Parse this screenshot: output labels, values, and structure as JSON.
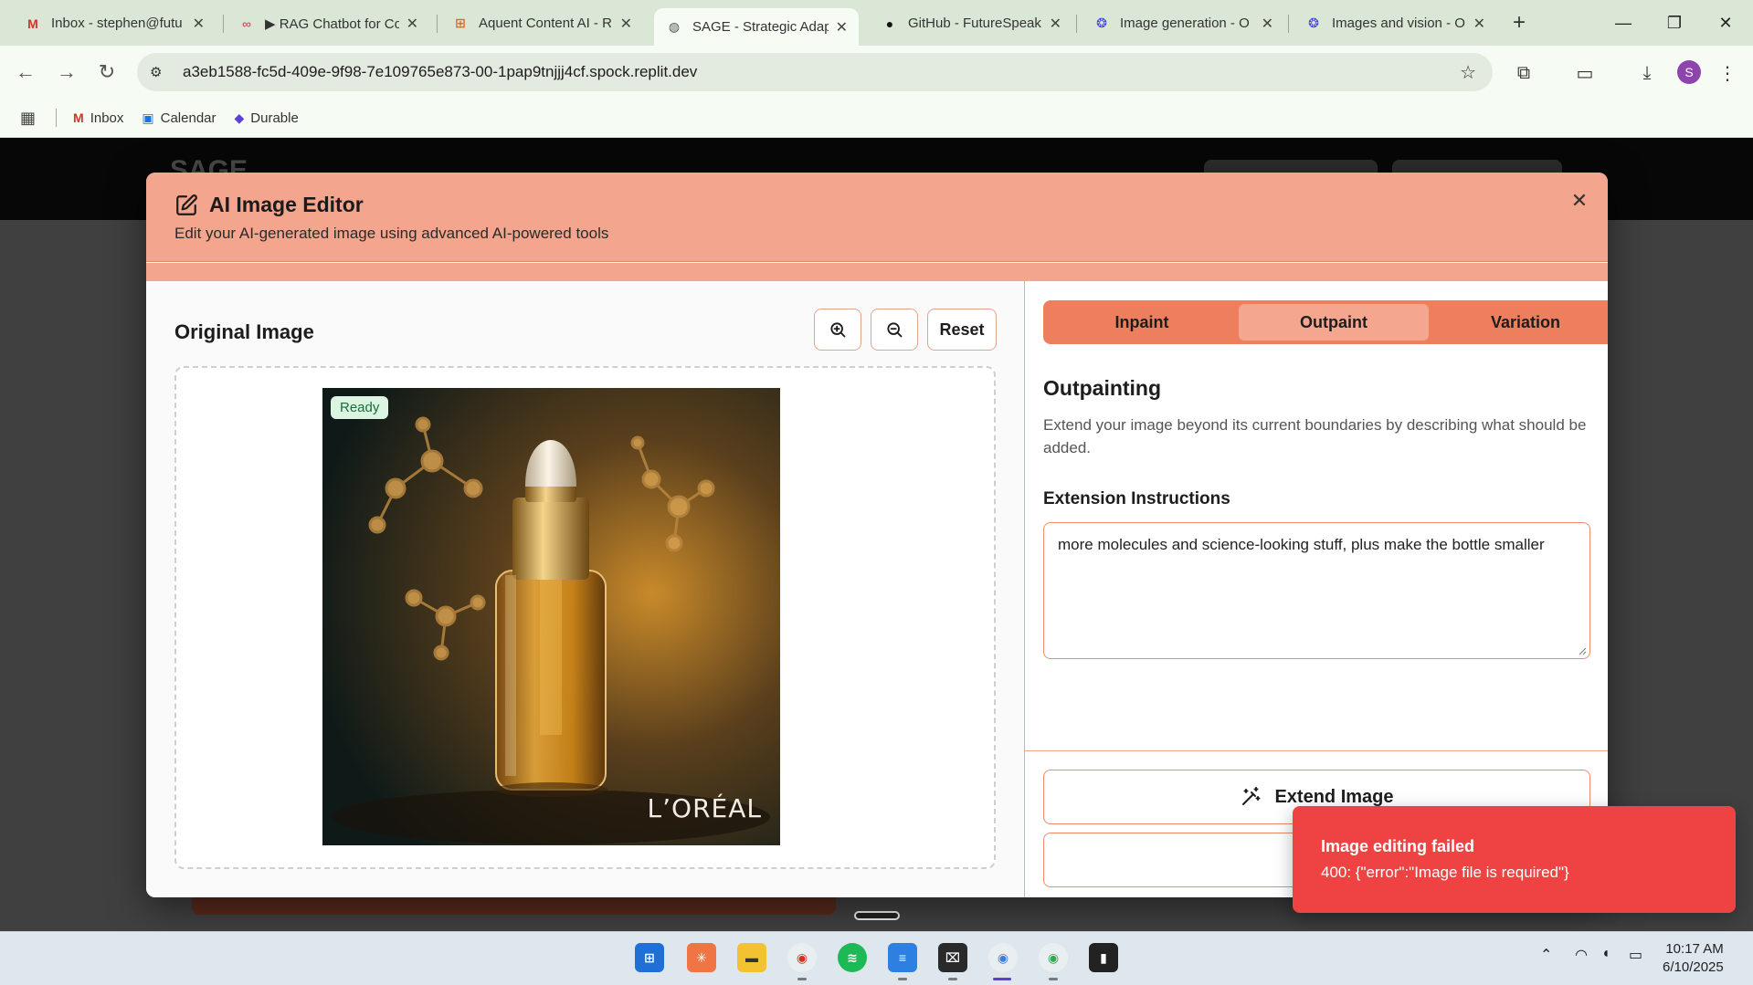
{
  "browser": {
    "tabs": [
      {
        "title": "Inbox - stephen@futu",
        "icon": "gmail-icon",
        "active": false
      },
      {
        "title": "▶ RAG Chatbot for Co",
        "icon": "workflow-icon",
        "active": false
      },
      {
        "title": "Aquent Content AI - R",
        "icon": "replit-icon",
        "active": false
      },
      {
        "title": "SAGE - Strategic Adap",
        "icon": "globe-icon",
        "active": true
      },
      {
        "title": "GitHub - FutureSpeak",
        "icon": "github-icon",
        "active": false
      },
      {
        "title": "Image generation - O",
        "icon": "openai-icon",
        "active": false
      },
      {
        "title": "Images and vision - O",
        "icon": "openai-icon",
        "active": false
      }
    ],
    "url": "a3eb1588-fc5d-409e-9f98-7e109765e873-00-1pap9tnjjj4cf.spock.replit.dev",
    "profile_initial": "S",
    "bookmarks": [
      {
        "label": "Inbox",
        "icon": "gmail-icon"
      },
      {
        "label": "Calendar",
        "icon": "calendar-icon"
      },
      {
        "label": "Durable",
        "icon": "durable-icon"
      }
    ]
  },
  "page": {
    "logo_text": "SAGE"
  },
  "modal": {
    "title": "AI Image Editor",
    "description": "Edit your AI-generated image using advanced AI-powered tools",
    "left": {
      "title": "Original Image",
      "reset_label": "Reset",
      "status_badge": "Ready",
      "brand_text": "L’ORÉAL"
    },
    "right": {
      "tabs": [
        "Inpaint",
        "Outpaint",
        "Variation"
      ],
      "active_tab": "Outpaint",
      "section_title": "Outpainting",
      "section_description": "Extend your image beyond its current boundaries by describing what should be added.",
      "field_label": "Extension Instructions",
      "field_value": "more molecules and science-looking stuff, plus make the bottle smaller",
      "primary_button": "Extend Image"
    }
  },
  "toast": {
    "title": "Image editing failed",
    "message": "400: {\"error\":\"Image file is required\"}"
  },
  "taskbar": {
    "time": "10:17 AM",
    "date": "6/10/2025"
  },
  "colors": {
    "accent": "#ee7f5e",
    "header": "#f3a58d",
    "toast": "#ef4343",
    "ready_badge": "#dcf5e2"
  }
}
